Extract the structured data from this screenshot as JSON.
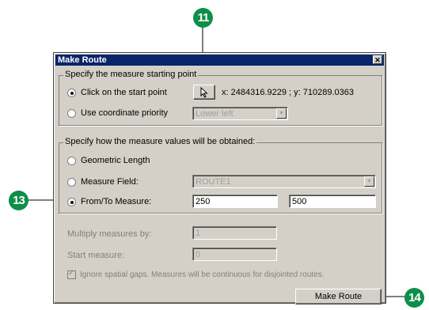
{
  "window": {
    "title": "Make Route",
    "close_glyph": "✕"
  },
  "start_point_group": {
    "legend": "Specify the measure starting point",
    "click_option": "Click on the start point",
    "coords_text": "x: 2484316.9229 ; y: 710289.0363",
    "coord_priority_option": "Use coordinate priority",
    "coord_priority_value": "Lower left"
  },
  "measure_group": {
    "legend": "Specify how the measure values will be obtained:",
    "geometric_option": "Geometric Length",
    "measure_field_option": "Measure Field:",
    "measure_field_value": "ROUTE1",
    "from_to_option": "From/To Measure:",
    "from_value": "250",
    "to_value": "500"
  },
  "multiply": {
    "label": "Multiply measures by:",
    "value": "1"
  },
  "start_measure": {
    "label": "Start measure:",
    "value": "0"
  },
  "ignore_gaps": {
    "label": "Ignore spatial gaps. Measures will be continuous for disjointed routes."
  },
  "make_route_button": "Make Route",
  "callouts": {
    "c11": "11",
    "c13": "13",
    "c14": "14"
  },
  "colors": {
    "callout": "#0d8f4a",
    "titlebar": "#0a246a",
    "dialog_bg": "#d4d0c8"
  },
  "icons": {
    "pointer": "arrow-cursor-icon",
    "dropdown": "chevron-down-icon"
  }
}
